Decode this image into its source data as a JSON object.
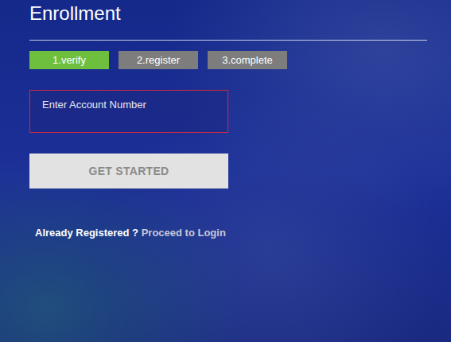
{
  "title": "Enrollment",
  "steps": [
    {
      "label": "1.verify",
      "selected": true
    },
    {
      "label": "2.register",
      "selected": false
    },
    {
      "label": "3.complete",
      "selected": false
    }
  ],
  "account_field": {
    "placeholder": "Enter Account Number",
    "error": true
  },
  "button": {
    "label": "GET STARTED",
    "disabled": true
  },
  "login_prompt": {
    "text": "Already Registered ?",
    "link": "Proceed to Login"
  }
}
